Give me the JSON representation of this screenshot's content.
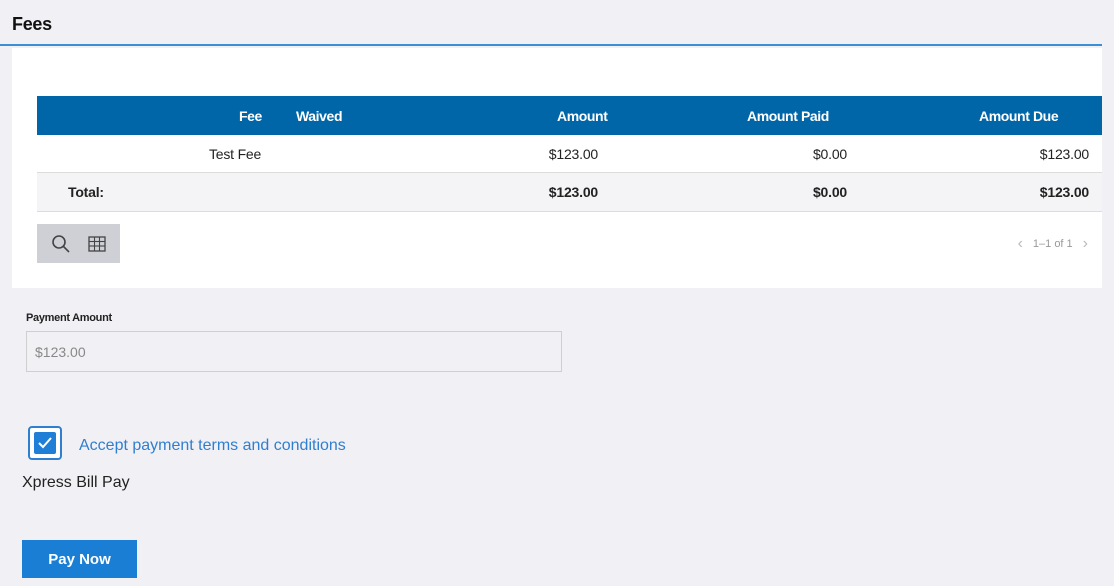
{
  "section": {
    "title": "Fees"
  },
  "table": {
    "columns": {
      "fee": "Fee",
      "waived": "Waived",
      "amount": "Amount",
      "amount_paid": "Amount Paid",
      "amount_due": "Amount Due"
    },
    "rows": [
      {
        "fee": "Test Fee",
        "waived": "",
        "amount": "$123.00",
        "amount_paid": "$0.00",
        "amount_due": "$123.00"
      }
    ],
    "total": {
      "label": "Total:",
      "amount": "$123.00",
      "amount_paid": "$0.00",
      "amount_due": "$123.00"
    },
    "toolbar": {
      "search_icon": "search-icon",
      "columns_icon": "grid-icon"
    },
    "pagination": {
      "range": "1–1 of 1"
    }
  },
  "payment": {
    "label": "Payment Amount",
    "value": "$123.00"
  },
  "terms": {
    "checked": true,
    "label": "Accept payment terms and conditions"
  },
  "provider": "Xpress Bill Pay",
  "pay_button": "Pay Now",
  "colors": {
    "header_blue": "#0066a8",
    "accent_blue": "#1a7ed4",
    "background": "#f1f0f5"
  }
}
